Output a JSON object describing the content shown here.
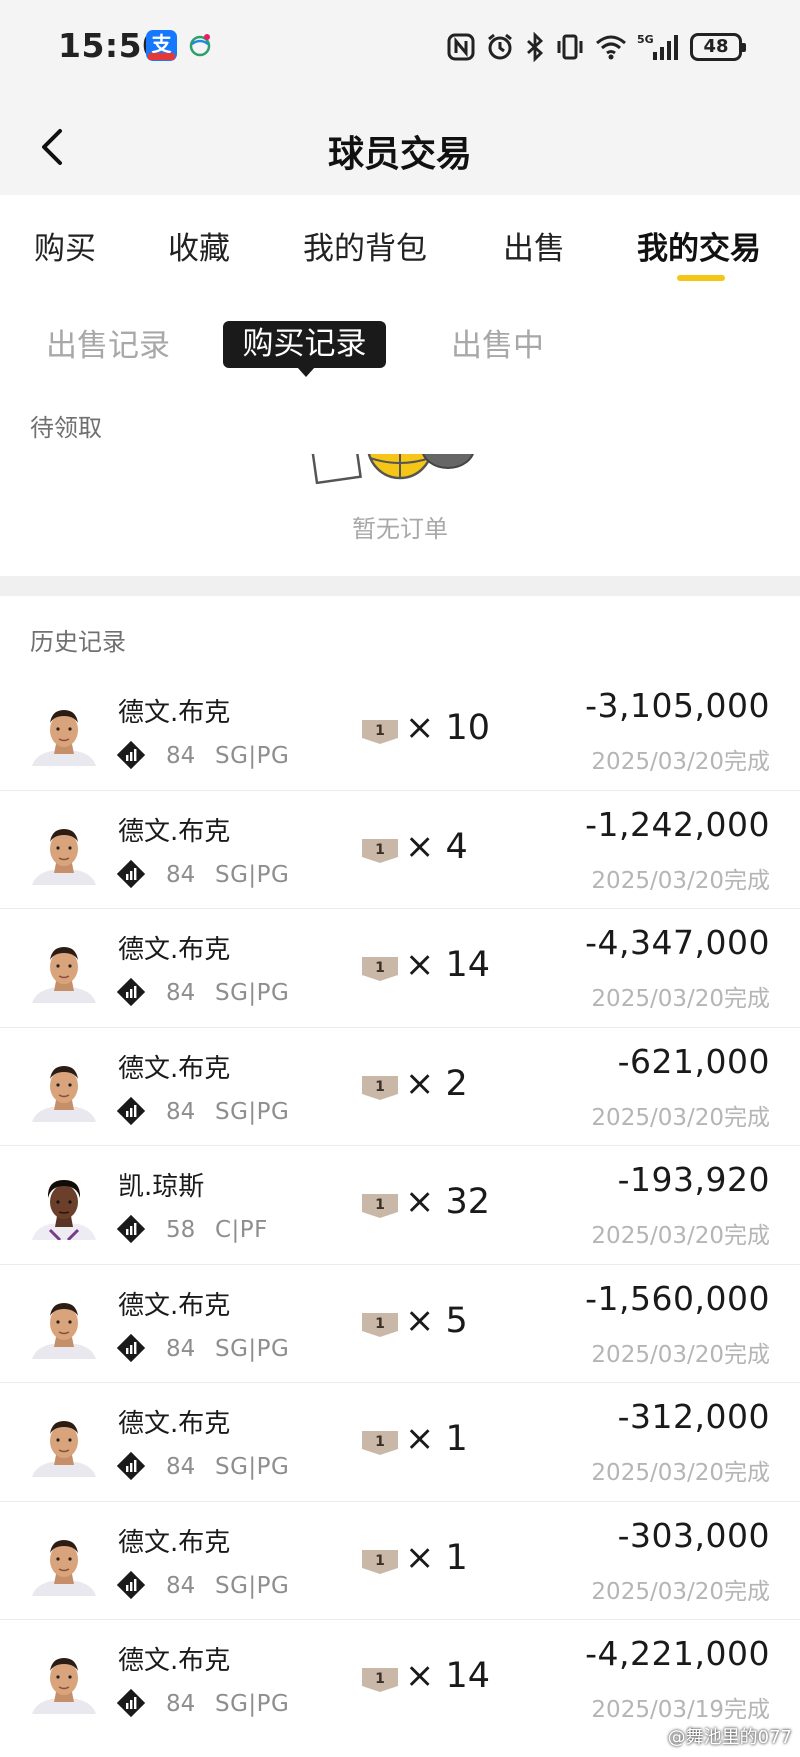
{
  "status_bar": {
    "time": "15:50",
    "app_badge": "支",
    "battery": "48",
    "network": "5G"
  },
  "header": {
    "title": "球员交易"
  },
  "main_tabs": [
    {
      "label": "购买",
      "active": false
    },
    {
      "label": "收藏",
      "active": false
    },
    {
      "label": "我的背包",
      "active": false
    },
    {
      "label": "出售",
      "active": false
    },
    {
      "label": "我的交易",
      "active": true
    }
  ],
  "sub_tabs": [
    {
      "label": "出售记录",
      "active": false
    },
    {
      "label": "购买记录",
      "active": true
    },
    {
      "label": "出售中",
      "active": false
    }
  ],
  "pending": {
    "label": "待领取",
    "empty_text": "暂无订单"
  },
  "history": {
    "label": "历史记录",
    "rows": [
      {
        "name": "德文.布克",
        "rating": "84",
        "position": "SG|PG",
        "qty": "× 10",
        "price": "-3,105,000",
        "date": "2025/03/20完成",
        "avatar": "booker"
      },
      {
        "name": "德文.布克",
        "rating": "84",
        "position": "SG|PG",
        "qty": "× 4",
        "price": "-1,242,000",
        "date": "2025/03/20完成",
        "avatar": "booker"
      },
      {
        "name": "德文.布克",
        "rating": "84",
        "position": "SG|PG",
        "qty": "× 14",
        "price": "-4,347,000",
        "date": "2025/03/20完成",
        "avatar": "booker"
      },
      {
        "name": "德文.布克",
        "rating": "84",
        "position": "SG|PG",
        "qty": "× 2",
        "price": "-621,000",
        "date": "2025/03/20完成",
        "avatar": "booker"
      },
      {
        "name": "凯.琼斯",
        "rating": "58",
        "position": "C|PF",
        "qty": "× 32",
        "price": "-193,920",
        "date": "2025/03/20完成",
        "avatar": "jones"
      },
      {
        "name": "德文.布克",
        "rating": "84",
        "position": "SG|PG",
        "qty": "× 5",
        "price": "-1,560,000",
        "date": "2025/03/20完成",
        "avatar": "booker"
      },
      {
        "name": "德文.布克",
        "rating": "84",
        "position": "SG|PG",
        "qty": "× 1",
        "price": "-312,000",
        "date": "2025/03/20完成",
        "avatar": "booker"
      },
      {
        "name": "德文.布克",
        "rating": "84",
        "position": "SG|PG",
        "qty": "× 1",
        "price": "-303,000",
        "date": "2025/03/20完成",
        "avatar": "booker"
      },
      {
        "name": "德文.布克",
        "rating": "84",
        "position": "SG|PG",
        "qty": "× 14",
        "price": "-4,221,000",
        "date": "2025/03/19完成",
        "avatar": "booker"
      }
    ]
  },
  "card_label": "1",
  "watermark": "@舞池里的077",
  "colors": {
    "accent": "#f5c518",
    "active_chip": "#1a1a1a",
    "card": "#c9b8a8",
    "muted_text": "#a8a8a8"
  }
}
